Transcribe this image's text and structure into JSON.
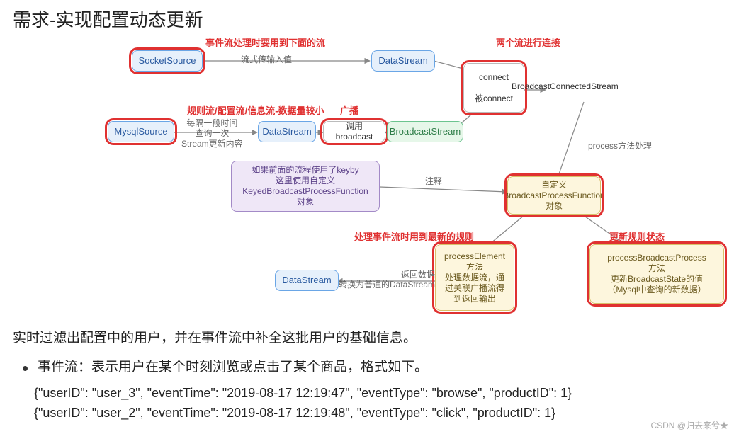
{
  "title": "需求-实现配置动态更新",
  "nodes": {
    "socketSource": "SocketSource",
    "dataStream1": "DataStream",
    "connectBox": "connect\n\n被connect",
    "broadcastConnectedStream": "BroadcastConnectedStream",
    "mysqlSource": "MysqlSource",
    "dataStream2": "DataStream",
    "callBroadcast": "调用broadcast",
    "broadcastStream": "BroadcastStream",
    "keyedFunc": "如果前面的流程使用了keyby\n这里使用自定义\nKeyedBroadcastProcessFunction\n对象",
    "customFunc": "自定义\nBroadcastProcessFunction\n对象",
    "processElement": "processElement\n方法\n处理数据流，通\n过关联广播流得\n到返回输出",
    "processBroadcast": "processBroadcastProcess\n方法\n更新BroadcastState的值\n（Mysql中查询的新数据）",
    "dataStream3": "DataStream"
  },
  "annotations": {
    "eventStreamNote": "事件流处理时要用到下面的流",
    "streamInput": "流式传输入值",
    "twoStreamConnect": "两个流进行连接",
    "ruleStreamNote": "规则流/配置流/信息流-数据量较小",
    "mysqlPoll": "每隔一段时间\n查询一次\nStream更新内容",
    "broadcastTag": "广播",
    "processMethod": "process方法处理",
    "injectNote": "注释",
    "processEventLatest": "处理事件流时用到最新的规则",
    "updateRuleState": "更新规则状态",
    "returnData": "返回数据\n转换为普通的DataStream"
  },
  "body": {
    "desc1": "实时过滤出配置中的用户，并在事件流中补全这批用户的基础信息。",
    "bulletLead": "事件流：表示用户在某个时刻浏览或点击了某个商品，格式如下。",
    "json1": "{\"userID\": \"user_3\", \"eventTime\": \"2019-08-17 12:19:47\", \"eventType\": \"browse\", \"productID\": 1}",
    "json2": "{\"userID\": \"user_2\", \"eventTime\": \"2019-08-17 12:19:48\", \"eventType\": \"click\", \"productID\": 1}"
  },
  "watermark": "CSDN @归去来兮★"
}
